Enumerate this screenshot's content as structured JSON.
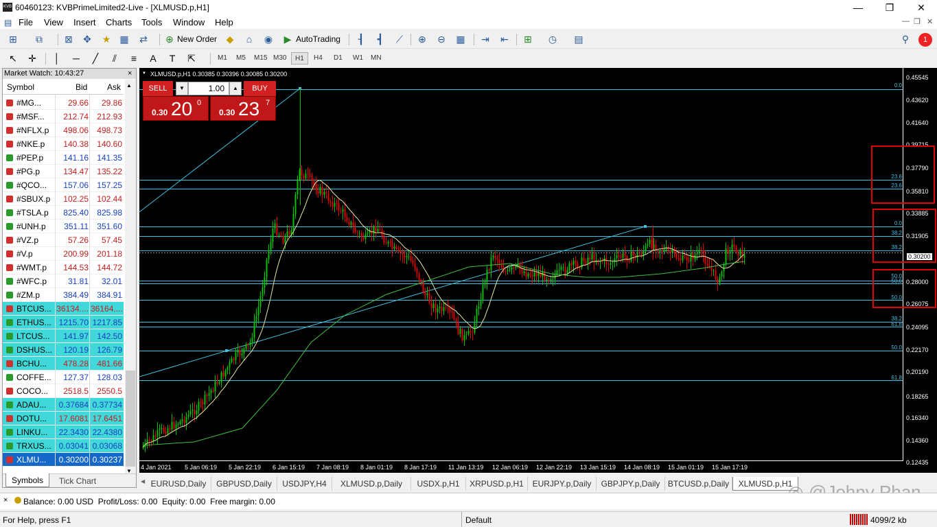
{
  "window": {
    "title": "60460123: KVBPrimeLimited2-Live - [XLMUSD.p,H1]",
    "min": "—",
    "restore": "❐",
    "close": "✕",
    "icon_text": "KVB"
  },
  "menu": [
    "File",
    "View",
    "Insert",
    "Charts",
    "Tools",
    "Window",
    "Help"
  ],
  "toolbar": {
    "new_order": "New Order",
    "autotrading": "AutoTrading"
  },
  "timeframes": [
    "M1",
    "M5",
    "M15",
    "M30",
    "H1",
    "H4",
    "D1",
    "W1",
    "MN"
  ],
  "active_timeframe": "H1",
  "market_watch": {
    "title": "Market Watch: 10:43:27",
    "close": "×",
    "cols": {
      "symbol": "Symbol",
      "bid": "Bid",
      "ask": "Ask"
    },
    "rows": [
      {
        "s": "#MG...",
        "b": "29.66",
        "a": "29.86",
        "c": "",
        "d": "down"
      },
      {
        "s": "#MSF...",
        "b": "212.74",
        "a": "212.93",
        "c": "",
        "d": "down"
      },
      {
        "s": "#NFLX.p",
        "b": "498.06",
        "a": "498.73",
        "c": "",
        "d": "down"
      },
      {
        "s": "#NKE.p",
        "b": "140.38",
        "a": "140.60",
        "c": "",
        "d": "down"
      },
      {
        "s": "#PEP.p",
        "b": "141.16",
        "a": "141.35",
        "c": "",
        "d": "up"
      },
      {
        "s": "#PG.p",
        "b": "134.47",
        "a": "135.22",
        "c": "",
        "d": "down"
      },
      {
        "s": "#QCO...",
        "b": "157.06",
        "a": "157.25",
        "c": "",
        "d": "up"
      },
      {
        "s": "#SBUX.p",
        "b": "102.25",
        "a": "102.44",
        "c": "",
        "d": "down"
      },
      {
        "s": "#TSLA.p",
        "b": "825.40",
        "a": "825.98",
        "c": "",
        "d": "up"
      },
      {
        "s": "#UNH.p",
        "b": "351.11",
        "a": "351.60",
        "c": "",
        "d": "up"
      },
      {
        "s": "#VZ.p",
        "b": "57.26",
        "a": "57.45",
        "c": "",
        "d": "down"
      },
      {
        "s": "#V.p",
        "b": "200.99",
        "a": "201.18",
        "c": "",
        "d": "down"
      },
      {
        "s": "#WMT.p",
        "b": "144.53",
        "a": "144.72",
        "c": "",
        "d": "down"
      },
      {
        "s": "#WFC.p",
        "b": "31.81",
        "a": "32.01",
        "c": "",
        "d": "up"
      },
      {
        "s": "#ZM.p",
        "b": "384.49",
        "a": "384.91",
        "c": "",
        "d": "up"
      },
      {
        "s": "BTCUS...",
        "b": "36134....",
        "a": "36164....",
        "c": "cy",
        "d": "down"
      },
      {
        "s": "ETHUS...",
        "b": "1215.70",
        "a": "1217.85",
        "c": "cy",
        "d": "up"
      },
      {
        "s": "LTCUS...",
        "b": "141.97",
        "a": "142.50",
        "c": "cy",
        "d": "up"
      },
      {
        "s": "DSHUS...",
        "b": "120.19",
        "a": "126.79",
        "c": "cy",
        "d": "up"
      },
      {
        "s": "BCHU...",
        "b": "478.28",
        "a": "481.66",
        "c": "cy",
        "d": "down"
      },
      {
        "s": "COFFE...",
        "b": "127.37",
        "a": "128.03",
        "c": "",
        "d": "up"
      },
      {
        "s": "COCO...",
        "b": "2518.5",
        "a": "2550.5",
        "c": "",
        "d": "down"
      },
      {
        "s": "ADAU...",
        "b": "0.37684",
        "a": "0.37734",
        "c": "cy",
        "d": "up"
      },
      {
        "s": "DOTU...",
        "b": "17.6081",
        "a": "17.6451",
        "c": "cy",
        "d": "down"
      },
      {
        "s": "LINKU...",
        "b": "22.3430",
        "a": "22.4380",
        "c": "cy",
        "d": "up"
      },
      {
        "s": "TRXUS...",
        "b": "0.03041",
        "a": "0.03068",
        "c": "cy",
        "d": "up"
      },
      {
        "s": "XLMU...",
        "b": "0.30200",
        "a": "0.30237",
        "c": "sel",
        "d": "down"
      }
    ],
    "tabs": [
      "Symbols",
      "Tick Chart"
    ]
  },
  "chart": {
    "header": "XLMUSD.p,H1  0.30385 0.30396 0.30085 0.30200",
    "sell": "SELL",
    "buy": "BUY",
    "volume": "1.00",
    "sell_small": "0.30",
    "sell_big": "20",
    "sell_sup": "0",
    "buy_small": "0.30",
    "buy_big": "23",
    "buy_sup": "7",
    "current_price": "0.30200",
    "price_labels": [
      "0.45545",
      "0.43620",
      "0.41640",
      "0.39715",
      "0.37790",
      "0.35810",
      "0.33885",
      "0.31905",
      "0.30200",
      "0.28000",
      "0.26075",
      "0.24095",
      "0.22170",
      "0.20190",
      "0.18265",
      "0.16340",
      "0.14360",
      "0.12435"
    ],
    "time_labels": [
      "4 Jan 2021",
      "5 Jan 06:19",
      "5 Jan 22:19",
      "6 Jan 15:19",
      "7 Jan 08:19",
      "8 Jan 01:19",
      "8 Jan 17:19",
      "11 Jan 13:19",
      "12 Jan 06:19",
      "12 Jan 22:19",
      "13 Jan 15:19",
      "14 Jan 08:19",
      "15 Jan 01:19",
      "15 Jan 17:19"
    ],
    "fib_labels": [
      "0.0",
      "23.6",
      "23.6",
      "0.0",
      "38.2",
      "38.2",
      "50.0",
      "50.0",
      "50.0",
      "38.2",
      "61.8",
      "50.0",
      "61.8"
    ],
    "colors": {
      "bull": "#00c000",
      "bear": "#e00000",
      "ma_fast": "#e8e8a0",
      "ma_slow": "#40c040",
      "fib": "#40c0e0",
      "trend": "#40c0e0"
    }
  },
  "chart_tabs": [
    "EURUSD,Daily",
    "GBPUSD,Daily",
    "USDJPY,H4",
    "XLMUSD.p,Daily",
    "USDX.p,H1",
    "XRPUSD.p,H1",
    "EURJPY.p,Daily",
    "GBPJPY.p,Daily",
    "BTCUSD.p,Daily",
    "XLMUSD.p,H1"
  ],
  "active_chart_tab": "XLMUSD.p,H1",
  "watermark": "@Johny Phan",
  "balance": "Balance: 0.00 USD  Profit/Loss: 0.00  Equity: 0.00  Free margin: 0.00",
  "status": {
    "help": "For Help, press F1",
    "profile": "Default",
    "traffic": "4099/2 kb"
  }
}
